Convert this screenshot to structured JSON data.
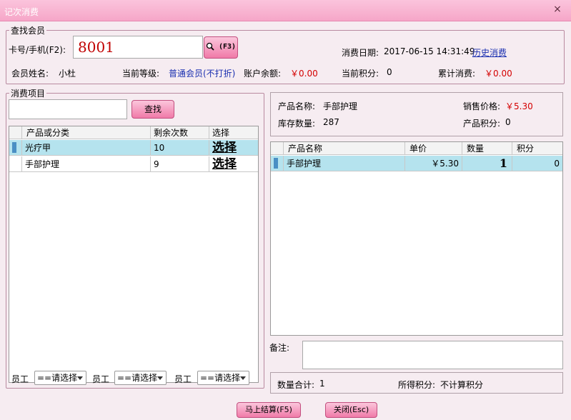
{
  "window": {
    "title": "记次消费",
    "close_glyph": "×"
  },
  "member_section": {
    "legend": "查找会员",
    "card_label": "卡号/手机(F2):",
    "card_value": "8001",
    "search_button_label": "(F3)",
    "consume_date_label": "消费日期:",
    "consume_date_value": "2017-06-15 14:31:49",
    "history_link": "历史消费",
    "name_label": "会员姓名:",
    "name_value": "小杜",
    "level_label": "当前等级:",
    "level_value": "普通会员(不打折)",
    "balance_label": "账户余额:",
    "balance_value": "￥0.00",
    "points_label": "当前积分:",
    "points_value": "0",
    "total_label": "累计消费:",
    "total_value": "￥0.00"
  },
  "items_section": {
    "legend": "消费项目",
    "search_placeholder": "",
    "find_button": "查找",
    "columns": [
      "产品或分类",
      "剩余次数",
      "选择"
    ],
    "rows": [
      {
        "name": "光疗甲",
        "remaining": "10",
        "action": "选择",
        "selected": true
      },
      {
        "name": "手部护理",
        "remaining": "9",
        "action": "选择",
        "selected": false
      }
    ]
  },
  "product_info": {
    "name_label": "产品名称:",
    "name_value": "手部护理",
    "price_label": "销售价格:",
    "price_value": "￥5.30",
    "stock_label": "库存数量:",
    "stock_value": "287",
    "points_label": "产品积分:",
    "points_value": "0"
  },
  "cart": {
    "columns": [
      "产品名称",
      "单价",
      "数量",
      "积分"
    ],
    "rows": [
      {
        "name": "手部护理",
        "price": "￥5.30",
        "qty": "1",
        "points": "0"
      }
    ]
  },
  "staff": {
    "label": "员工",
    "selects": [
      "==请选择",
      "==请选择",
      "==请选择"
    ]
  },
  "remark": {
    "label": "备注:",
    "value": ""
  },
  "summary": {
    "qty_label": "数量合计:",
    "qty_value": "1",
    "points_label": "所得积分:",
    "points_value": "不计算积分"
  },
  "footer": {
    "checkout_button": "马上结算(F5)",
    "close_button": "关闭(Esc)"
  },
  "colors": {
    "title_bar": "#f6a6c8",
    "accent_pink": "#f07aa8",
    "selected_row": "#b5e3ee",
    "money_red": "#d40000"
  }
}
